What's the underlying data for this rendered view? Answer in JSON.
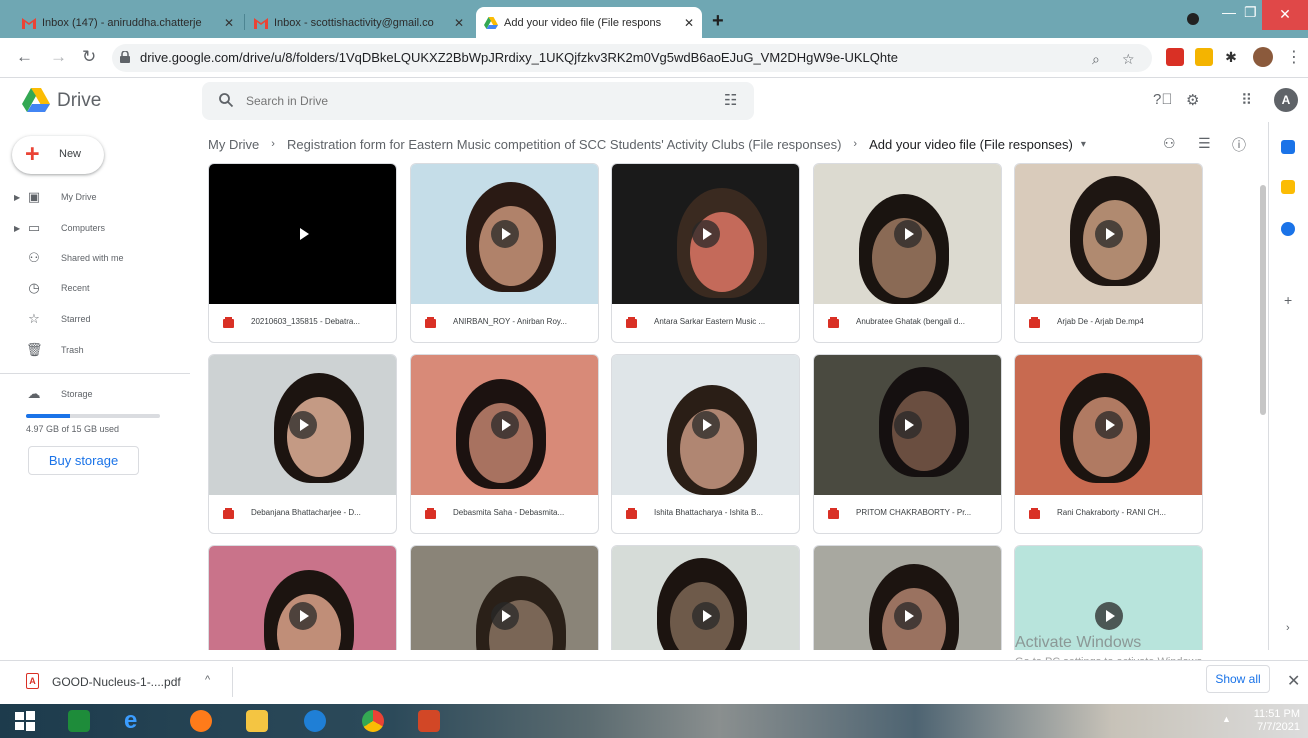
{
  "browser": {
    "tabs": [
      {
        "title": "Inbox (147) - aniruddha.chatterje",
        "active": false,
        "favicon": "gmail-icon"
      },
      {
        "title": "Inbox - scottishactivity@gmail.co",
        "active": false,
        "favicon": "gmail-icon"
      },
      {
        "title": "Add your video file (File respons",
        "active": true,
        "favicon": "drive-icon"
      }
    ],
    "new_tab_symbol": "+",
    "url": "drive.google.com/drive/u/8/folders/1VqDBkeLQUKXZ2BbWpJRrdixy_1UKQjfzkv3RK2m0Vg5wdB6aoEJuG_VM2DHgW9e-UKLQhte"
  },
  "drive": {
    "app_name": "Drive",
    "search_placeholder": "Search in Drive",
    "account_initial": "A",
    "new_label": "New",
    "nav": [
      {
        "label": "My Drive",
        "icon": "my-drive-icon",
        "expandable": true
      },
      {
        "label": "Computers",
        "icon": "computers-icon",
        "expandable": true
      },
      {
        "label": "Shared with me",
        "icon": "shared-icon",
        "expandable": false
      },
      {
        "label": "Recent",
        "icon": "clock-icon",
        "expandable": false
      },
      {
        "label": "Starred",
        "icon": "star-icon",
        "expandable": false
      },
      {
        "label": "Trash",
        "icon": "trash-icon",
        "expandable": false
      }
    ],
    "storage": {
      "label": "Storage",
      "used_text": "4.97 GB of 15 GB used",
      "used_fraction": 0.33,
      "buy_label": "Buy storage"
    },
    "breadcrumb": {
      "root": "My Drive",
      "parent": "Registration form for Eastern Music competition of SCC Students' Activity Clubs (File responses)",
      "current": "Add your video file (File responses)"
    },
    "files": [
      {
        "name": "20210603_135815 - Debatra...",
        "bg": "#000000",
        "face": "",
        "hair": ""
      },
      {
        "name": "ANIRBAN_ROY - Anirban Roy...",
        "bg": "#c5dde8",
        "face": "#b0826a",
        "hair": "#2a1a14"
      },
      {
        "name": "Antara Sarkar Eastern Music ...",
        "bg": "#1a1a1a",
        "face": "#c46a5a",
        "hair": "#3a2a20"
      },
      {
        "name": "Anubratee Ghatak (bengali d...",
        "bg": "#dcdad0",
        "face": "#8a6a55",
        "hair": "#1a1410"
      },
      {
        "name": "Arjab De - Arjab De.mp4",
        "bg": "#d9cbbb",
        "face": "#b08a70",
        "hair": "#1e1612"
      },
      {
        "name": "Debanjana Bhattacharjee - D...",
        "bg": "#cdd2d3",
        "face": "#c49a84",
        "hair": "#1c1410"
      },
      {
        "name": "Debasmita Saha - Debasmita...",
        "bg": "#d88a78",
        "face": "#a87260",
        "hair": "#1c1210"
      },
      {
        "name": "Ishita Bhattacharya - Ishita B...",
        "bg": "#dfe5e8",
        "face": "#b08672",
        "hair": "#2a1e16"
      },
      {
        "name": "PRITOM CHAKRABORTY - Pr...",
        "bg": "#4a4a40",
        "face": "#6a4e40",
        "hair": "#151010"
      },
      {
        "name": "Rani Chakraborty - RANI CH...",
        "bg": "#c86a50",
        "face": "#b07a62",
        "hair": "#1c1410"
      },
      {
        "name": "",
        "bg": "#c9738a",
        "face": "#c08e78",
        "hair": "#1c1410"
      },
      {
        "name": "",
        "bg": "#8a8478",
        "face": "#7a6656",
        "hair": "#2a2018"
      },
      {
        "name": "",
        "bg": "#d6dcd8",
        "face": "#6e5a4a",
        "hair": "#1c1410"
      },
      {
        "name": "",
        "bg": "#a8a8a0",
        "face": "#9a7260",
        "hair": "#1c1410"
      },
      {
        "name": "",
        "bg": "#b8e4dc",
        "face": "",
        "hair": ""
      }
    ]
  },
  "watermark": {
    "line1": "Activate Windows",
    "line2": "Go to PC settings to activate Windows."
  },
  "download_bar": {
    "file_name": "GOOD-Nucleus-1-....pdf",
    "show_all_label": "Show all"
  },
  "taskbar": {
    "time": "11:51 PM",
    "date": "7/7/2021"
  }
}
